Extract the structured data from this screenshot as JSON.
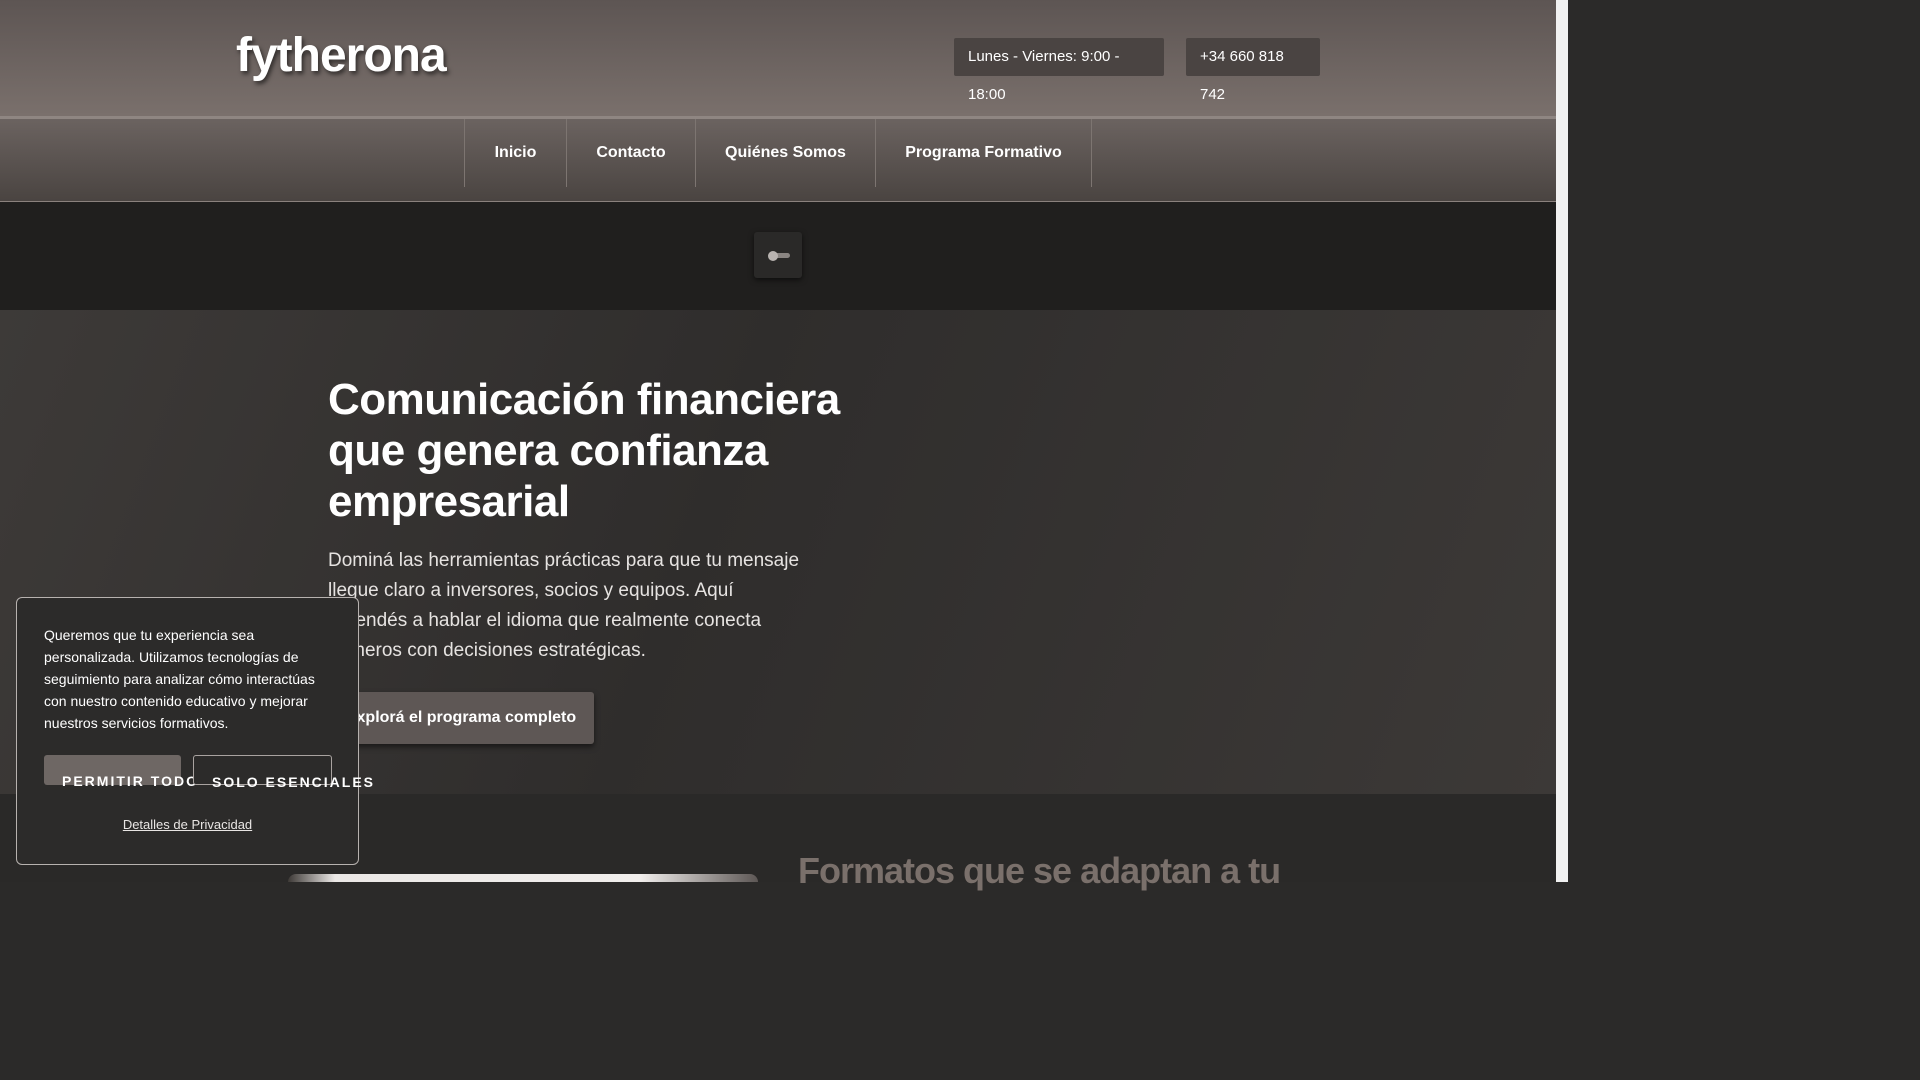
{
  "header": {
    "logo": "fytherona",
    "hours": "Lunes - Viernes: 9:00 - 18:00",
    "phone": "+34 660 818 742"
  },
  "nav": {
    "items": [
      {
        "label": "Inicio"
      },
      {
        "label": "Contacto"
      },
      {
        "label": "Quiénes Somos"
      },
      {
        "label": "Programa Formativo"
      }
    ]
  },
  "theme_toggle": {
    "icon": "toggle-switch-icon"
  },
  "hero": {
    "title": "Comunicación financiera que genera confianza empresarial",
    "text": "Dominá las herramientas prácticas para que tu mensaje llegue claro a inversores, socios y equipos. Aquí aprendés a hablar el idioma que realmente conecta números con decisiones estratégicas.",
    "cta": "Explorá el programa completo"
  },
  "section": {
    "title": "Formatos que se adaptan a tu"
  },
  "cookie": {
    "text": "Queremos que tu experiencia sea personalizada. Utilizamos tecnologías de seguimiento para analizar cómo interactúas con nuestro contenido educativo y mejorar nuestros servicios formativos.",
    "allow": "PERMITIR TODO",
    "essentials": "SOLO ESENCIALES",
    "privacy": "Detalles de Privacidad"
  },
  "colors": {
    "header_bg": "#6b6360",
    "body_bg": "#2b2a29",
    "accent": "#5e5755"
  }
}
